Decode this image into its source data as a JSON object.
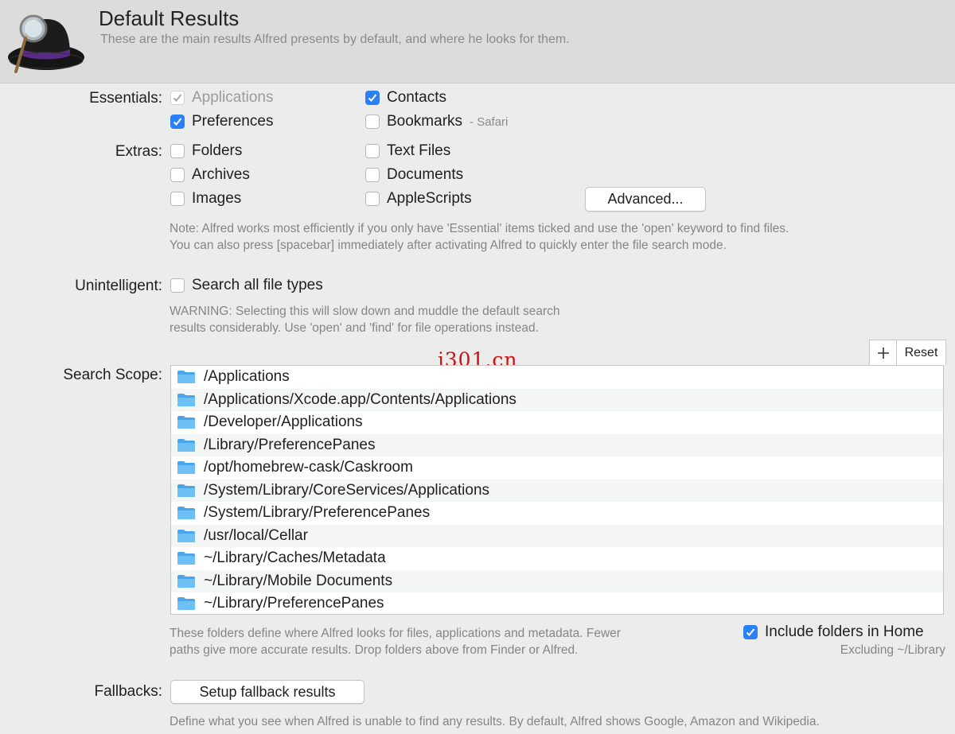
{
  "header": {
    "title": "Default Results",
    "subtitle": "These are the main results Alfred presents by default, and where he looks for them."
  },
  "essentials": {
    "label": "Essentials:",
    "applications": "Applications",
    "contacts": "Contacts",
    "preferences": "Preferences",
    "bookmarks": "Bookmarks",
    "bookmarks_suffix": "- Safari"
  },
  "extras": {
    "label": "Extras:",
    "folders": "Folders",
    "text_files": "Text Files",
    "archives": "Archives",
    "documents": "Documents",
    "images": "Images",
    "applescripts": "AppleScripts",
    "advanced_button": "Advanced..."
  },
  "extras_note": "Note: Alfred works most efficiently if you only have 'Essential' items ticked and use the 'open' keyword to find files.\nYou can also press [spacebar] immediately after activating Alfred to quickly enter the file search mode.",
  "unintelligent": {
    "label": "Unintelligent:",
    "search_all": "Search all file types",
    "warning": "WARNING: Selecting this will slow down and muddle the default search\nresults considerably. Use 'open' and 'find' for file operations instead."
  },
  "search_scope": {
    "label": "Search Scope:",
    "reset_button": "Reset",
    "paths": [
      "/Applications",
      "/Applications/Xcode.app/Contents/Applications",
      "/Developer/Applications",
      "/Library/PreferencePanes",
      "/opt/homebrew-cask/Caskroom",
      "/System/Library/CoreServices/Applications",
      "/System/Library/PreferencePanes",
      "/usr/local/Cellar",
      "~/Library/Caches/Metadata",
      "~/Library/Mobile Documents",
      "~/Library/PreferencePanes"
    ],
    "note": "These folders define where Alfred looks for files, applications and metadata. Fewer\npaths give more accurate results. Drop folders above from Finder or Alfred.",
    "include_home": "Include folders in Home",
    "excluding": "Excluding ~/Library"
  },
  "fallbacks": {
    "label": "Fallbacks:",
    "setup_button": "Setup fallback results",
    "note": "Define what you see when Alfred is unable to find any results. By default, Alfred shows Google, Amazon and Wikipedia."
  },
  "watermark": "j301.cn",
  "colors": {
    "accent": "#2a80f7",
    "folder": "#5fb8f3"
  }
}
